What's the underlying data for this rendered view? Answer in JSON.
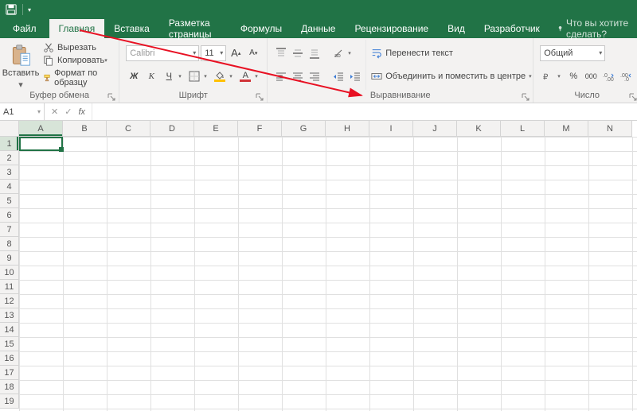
{
  "qat": {
    "save_title": "Сохранить"
  },
  "tabs": {
    "file": "Файл",
    "home": "Главная",
    "insert": "Вставка",
    "layout": "Разметка страницы",
    "formulas": "Формулы",
    "data": "Данные",
    "review": "Рецензирование",
    "view": "Вид",
    "developer": "Разработчик",
    "tell_me": "Что вы хотите сделать?"
  },
  "ribbon": {
    "clipboard": {
      "paste": "Вставить",
      "cut": "Вырезать",
      "copy": "Копировать",
      "format_painter": "Формат по образцу",
      "group_label": "Буфер обмена"
    },
    "font": {
      "name": "Calibri",
      "size": "11",
      "bold": "Ж",
      "italic": "К",
      "underline": "Ч",
      "increase": "A",
      "decrease": "A",
      "fill_letter": "A",
      "color_letter": "A",
      "group_label": "Шрифт"
    },
    "alignment": {
      "wrap": "Перенести текст",
      "merge": "Объединить и поместить в центре",
      "group_label": "Выравнивание"
    },
    "number": {
      "format": "Общий",
      "percent": "%",
      "comma": "000",
      "inc_dec": "⁰₀",
      "dec_dec": "₀⁰",
      "group_label": "Число"
    }
  },
  "formula_bar": {
    "name_box": "A1",
    "cancel": "✕",
    "enter": "✓",
    "fx": "fx"
  },
  "grid": {
    "cols": [
      "A",
      "B",
      "C",
      "D",
      "E",
      "F",
      "G",
      "H",
      "I",
      "J",
      "K",
      "L",
      "M",
      "N"
    ],
    "rows": [
      "1",
      "2",
      "3",
      "4",
      "5",
      "6",
      "7",
      "8",
      "9",
      "10",
      "11",
      "12",
      "13",
      "14",
      "15",
      "16",
      "17",
      "18",
      "19"
    ],
    "selected_cell": "A1"
  }
}
